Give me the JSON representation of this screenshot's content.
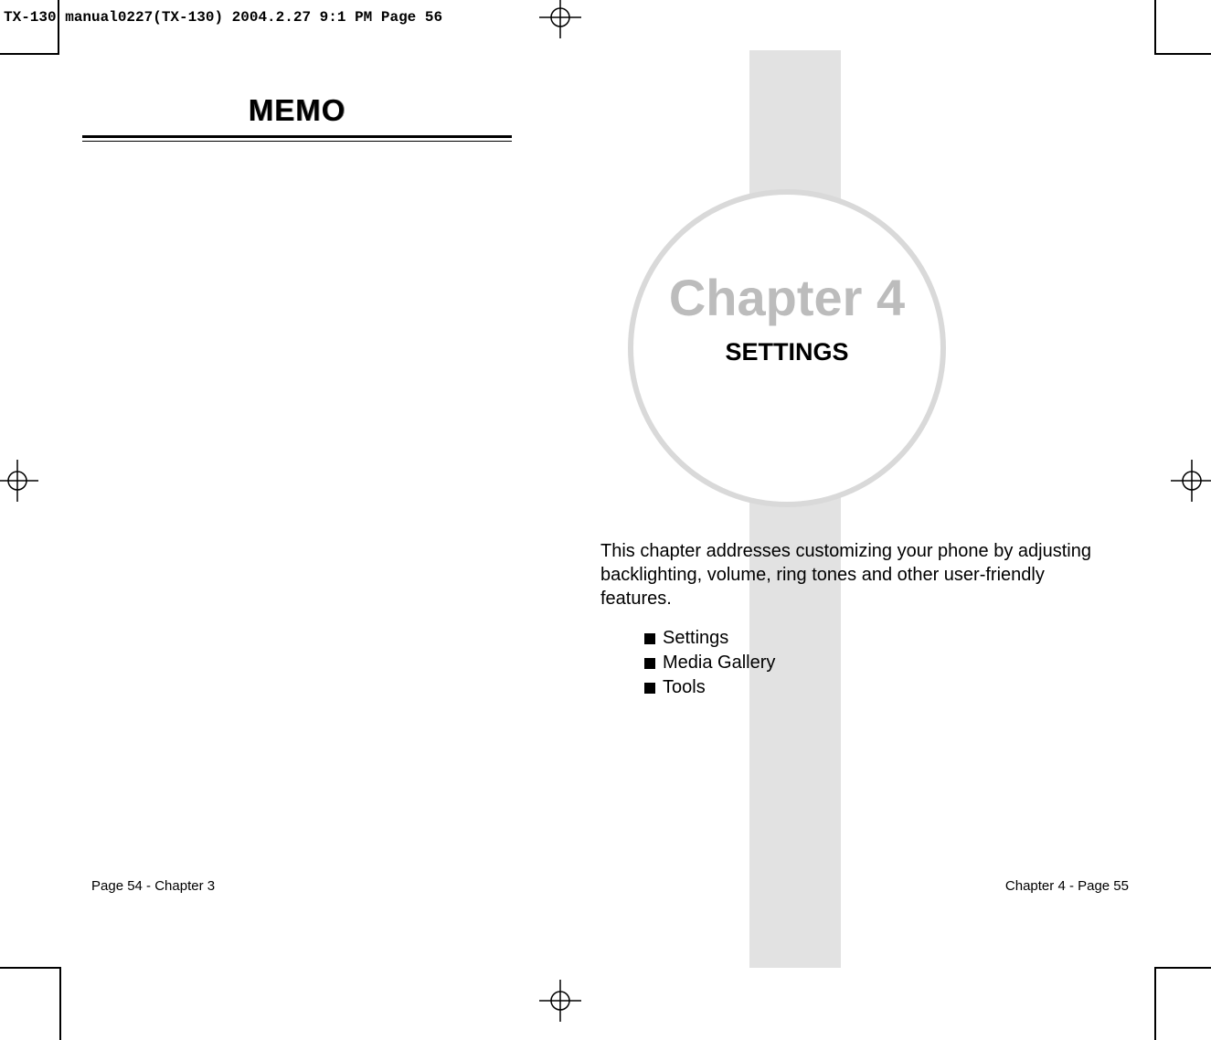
{
  "header": {
    "meta_line": "TX-130 manual0227(TX-130)  2004.2.27  9:1 PM  Page 56"
  },
  "left_page": {
    "memo_title": "MEMO",
    "footer": "Page 54 - Chapter 3"
  },
  "right_page": {
    "chapter_title": "Chapter 4",
    "chapter_subtitle": "SETTINGS",
    "description": "This chapter addresses customizing your phone by adjusting backlighting, volume, ring tones and other user-friendly features.",
    "list": {
      "item1": "Settings",
      "item2": "Media Gallery",
      "item3": "Tools"
    },
    "footer": "Chapter 4 - Page 55"
  }
}
